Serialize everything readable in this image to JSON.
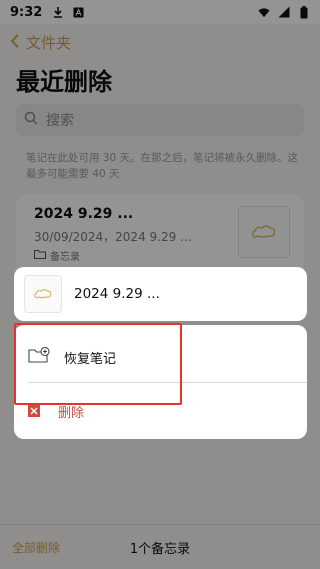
{
  "status_bar": {
    "time": "9:32"
  },
  "header": {
    "back_label": "文件夹",
    "title": "最近删除"
  },
  "search": {
    "placeholder": "搜索"
  },
  "info_text": "笔记在此处可用 30 天。在那之后，笔记将被永久删除。这最多可能需要 40 天",
  "note": {
    "title": "2024 9.29 ...",
    "subtitle": "30/09/2024，2024 9.29 ...",
    "folder": "备忘录"
  },
  "footer": {
    "delete_all_label": "全部删除",
    "count_label": "1个备忘录"
  },
  "preview": {
    "title": "2024 9.29 ..."
  },
  "actions": {
    "restore_label": "恢复笔记",
    "delete_label": "删除"
  },
  "colors": {
    "accent": "#caa24a",
    "danger": "#d24a3c",
    "highlight": "#e5332a"
  }
}
